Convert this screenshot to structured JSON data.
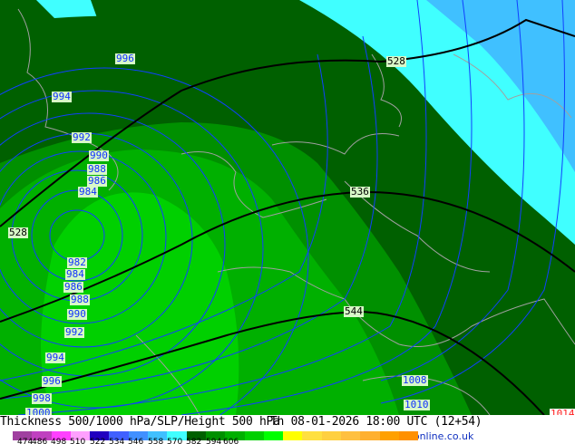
{
  "map": {
    "isobar_labels": [
      "996",
      "994",
      "992",
      "990",
      "988",
      "986",
      "984",
      "982",
      "984",
      "986",
      "988",
      "990",
      "992",
      "994",
      "996",
      "998",
      "1000",
      "1008",
      "1010",
      "1014"
    ],
    "thickness_labels": [
      "528",
      "528",
      "536",
      "544"
    ],
    "colors": {
      "cyan_light": "#40ffff",
      "cyan": "#40c0ff",
      "green_dark": "#006000",
      "green2": "#009000",
      "green3": "#00b000",
      "green4": "#00d000",
      "isobar": "#1040ff",
      "border": "#a0a0a0"
    }
  },
  "footer": {
    "title": "Thickness 500/1000 hPa/SLP/Height 500 hPa",
    "datetime": "Th 08-01-2026 18:00 UTC (12+54)",
    "credit": "©weatheronline.co.uk",
    "colorbar": {
      "ticks": [
        "474",
        "486",
        "498",
        "510",
        "522",
        "534",
        "546",
        "558",
        "570",
        "582",
        "594",
        "606"
      ],
      "colors": [
        "#a040a0",
        "#c040c0",
        "#ff40ff",
        "#ffa0ff",
        "#2000c0",
        "#4060ff",
        "#4090ff",
        "#40c0ff",
        "#40ffff",
        "#006000",
        "#009000",
        "#00b000",
        "#00d000",
        "#00ff00",
        "#ffff00",
        "#ffe040",
        "#ffd040",
        "#ffc040",
        "#ffb030",
        "#ffa000",
        "#ff9000"
      ]
    }
  }
}
